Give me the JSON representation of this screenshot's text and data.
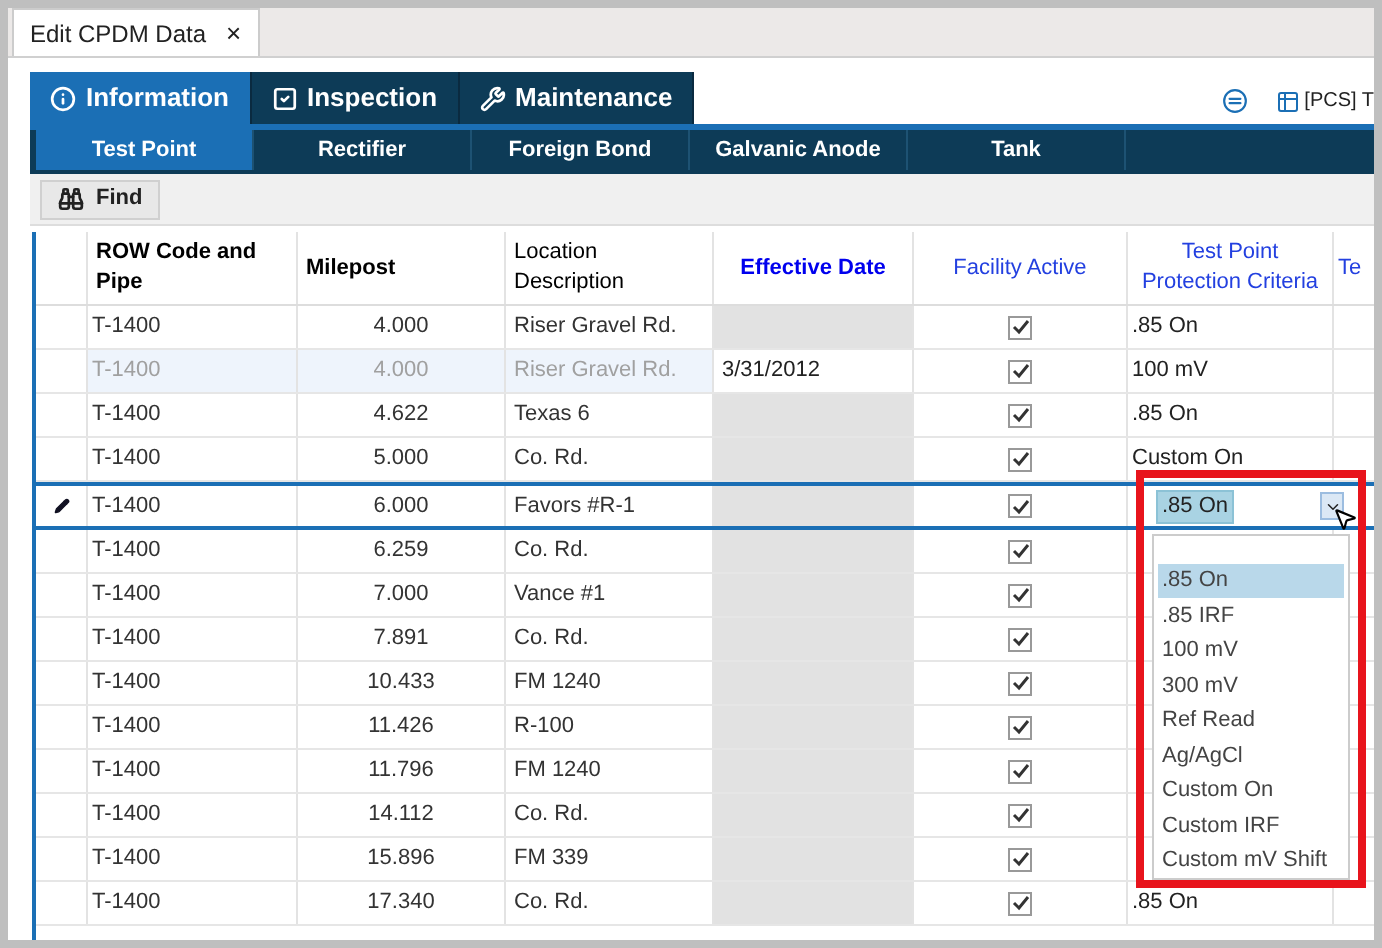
{
  "doc_tab": {
    "title": "Edit CPDM Data",
    "close": "×"
  },
  "main_tabs": [
    {
      "label": "Information",
      "selected": true
    },
    {
      "label": "Inspection",
      "selected": false
    },
    {
      "label": "Maintenance",
      "selected": false
    }
  ],
  "toolbar_right": {
    "label": "[PCS] T"
  },
  "sub_tabs": [
    {
      "label": "Test Point",
      "selected": true
    },
    {
      "label": "Rectifier",
      "selected": false
    },
    {
      "label": "Foreign Bond",
      "selected": false
    },
    {
      "label": "Galvanic Anode",
      "selected": false
    },
    {
      "label": "Tank",
      "selected": false
    }
  ],
  "find_button": {
    "label": "Find"
  },
  "table": {
    "columns": [
      {
        "label": "ROW Code and Pipe",
        "bold": true,
        "blue": false
      },
      {
        "label": "Milepost",
        "bold": true,
        "blue": false
      },
      {
        "label": "Location Description",
        "bold": false,
        "blue": false
      },
      {
        "label": "Effective Date",
        "bold": true,
        "blue": true
      },
      {
        "label": "Facility Active",
        "bold": false,
        "blue": true
      },
      {
        "label": "Test Point Protection Criteria",
        "bold": false,
        "blue": true
      },
      {
        "label": "Te",
        "bold": false,
        "blue": true
      }
    ],
    "rows": [
      {
        "row_code": "T-1400",
        "milepost": "4.000",
        "location": "Riser Gravel Rd.",
        "effective_date": "",
        "active": true,
        "criteria": ".85 On",
        "dimmed": false,
        "editing": false
      },
      {
        "row_code": "T-1400",
        "milepost": "4.000",
        "location": "Riser Gravel Rd.",
        "effective_date": "3/31/2012",
        "active": true,
        "criteria": "100 mV",
        "dimmed": true,
        "editing": false
      },
      {
        "row_code": "T-1400",
        "milepost": "4.622",
        "location": "Texas 6",
        "effective_date": "",
        "active": true,
        "criteria": ".85 On",
        "dimmed": false,
        "editing": false
      },
      {
        "row_code": "T-1400",
        "milepost": "5.000",
        "location": "Co. Rd.",
        "effective_date": "",
        "active": true,
        "criteria": "Custom On",
        "dimmed": false,
        "editing": false
      },
      {
        "row_code": "T-1400",
        "milepost": "6.000",
        "location": "Favors #R-1",
        "effective_date": "",
        "active": true,
        "dimmed": false,
        "editing": true
      },
      {
        "row_code": "T-1400",
        "milepost": "6.259",
        "location": "Co. Rd.",
        "effective_date": "",
        "active": true,
        "dimmed": false,
        "editing": false
      },
      {
        "row_code": "T-1400",
        "milepost": "7.000",
        "location": "Vance #1",
        "effective_date": "",
        "active": true,
        "dimmed": false,
        "editing": false
      },
      {
        "row_code": "T-1400",
        "milepost": "7.891",
        "location": "Co. Rd.",
        "effective_date": "",
        "active": true,
        "dimmed": false,
        "editing": false
      },
      {
        "row_code": "T-1400",
        "milepost": "10.433",
        "location": "FM 1240",
        "effective_date": "",
        "active": true,
        "dimmed": false,
        "editing": false
      },
      {
        "row_code": "T-1400",
        "milepost": "11.426",
        "location": "R-100",
        "effective_date": "",
        "active": true,
        "dimmed": false,
        "editing": false
      },
      {
        "row_code": "T-1400",
        "milepost": "11.796",
        "location": "FM 1240",
        "effective_date": "",
        "active": true,
        "dimmed": false,
        "editing": false
      },
      {
        "row_code": "T-1400",
        "milepost": "14.112",
        "location": "Co. Rd.",
        "effective_date": "",
        "active": true,
        "dimmed": false,
        "editing": false
      },
      {
        "row_code": "T-1400",
        "milepost": "15.896",
        "location": "FM 339",
        "effective_date": "",
        "active": true,
        "dimmed": false,
        "editing": false
      },
      {
        "row_code": "T-1400",
        "milepost": "17.340",
        "location": "Co. Rd.",
        "effective_date": "",
        "active": true,
        "criteria": ".85 On",
        "dimmed": false,
        "editing": false
      }
    ]
  },
  "dropdown": {
    "value": ".85 On",
    "options": [
      {
        "label": ".85 On",
        "selected": true
      },
      {
        "label": ".85 IRF",
        "selected": false
      },
      {
        "label": "100 mV",
        "selected": false
      },
      {
        "label": "300 mV",
        "selected": false
      },
      {
        "label": "Ref Read",
        "selected": false
      },
      {
        "label": "Ag/AgCl",
        "selected": false
      },
      {
        "label": "Custom On",
        "selected": false
      },
      {
        "label": "Custom IRF",
        "selected": false
      },
      {
        "label": "Custom mV Shift",
        "selected": false
      }
    ]
  }
}
